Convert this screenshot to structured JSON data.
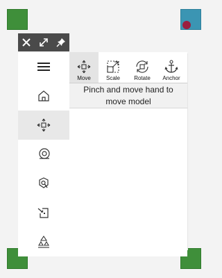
{
  "toolbar": {
    "close_icon": "close-icon",
    "expand_icon": "expand-icon",
    "pin_icon": "pin-icon"
  },
  "sidebar": {
    "items": [
      {
        "icon": "menu-icon",
        "selected": false
      },
      {
        "icon": "home-icon",
        "selected": false
      },
      {
        "icon": "move-icon",
        "selected": true
      },
      {
        "icon": "tape-icon",
        "selected": false
      },
      {
        "icon": "search-settings-icon",
        "selected": false
      },
      {
        "icon": "import-icon",
        "selected": false
      },
      {
        "icon": "shapes-icon",
        "selected": false
      }
    ]
  },
  "tabs": [
    {
      "label": "Move",
      "icon": "move-icon",
      "active": true
    },
    {
      "label": "Scale",
      "icon": "scale-icon",
      "active": false
    },
    {
      "label": "Rotate",
      "icon": "rotate-icon",
      "active": false
    },
    {
      "label": "Anchor",
      "icon": "anchor-icon",
      "active": false
    }
  ],
  "instruction": "Pinch and move hand to move model",
  "colors": {
    "corner_green": "#3f8f3a",
    "corner_blue": "#3b95b3",
    "corner_dot": "#9b1e3f",
    "toolbar_bg": "#4a4a4a"
  }
}
